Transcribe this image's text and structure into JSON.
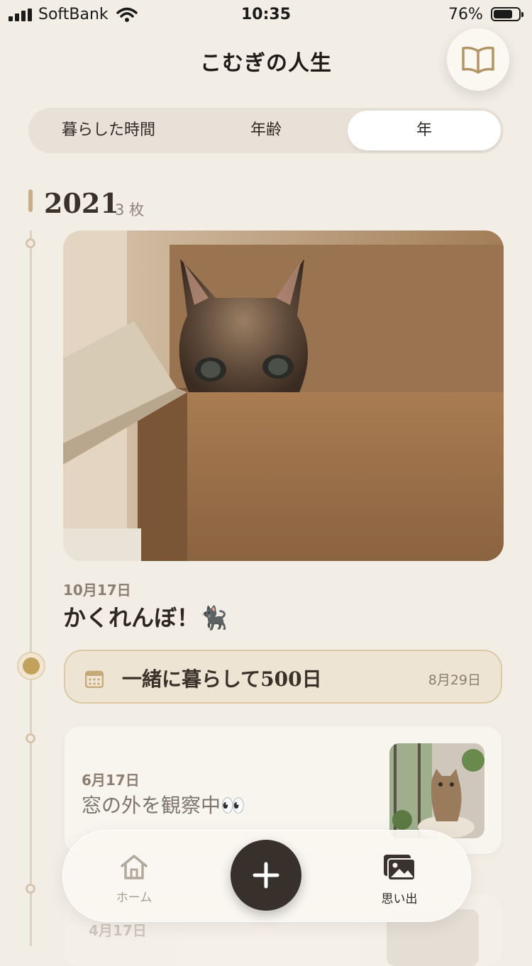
{
  "status_bar": {
    "carrier": "SoftBank",
    "time": "10:35",
    "battery": "76%",
    "battery_level": 0.76
  },
  "header": {
    "title": "こむぎの人生",
    "book_icon": "book-open-icon"
  },
  "segments": {
    "items": [
      "暮らした時間",
      "年齢",
      "年"
    ],
    "selected": "年"
  },
  "year_section": {
    "year": "2021",
    "count": "3 枚"
  },
  "entries": [
    {
      "date": "10月17日",
      "title": "かくれんぼ！🐈‍⬛"
    },
    {
      "date": "6月17日",
      "title": "窓の外を観察中👀"
    },
    {
      "date": "4月17日"
    }
  ],
  "milestone": {
    "label": "一緒に暮らして500日",
    "date": "8月29日",
    "icon": "calendar-icon"
  },
  "tabbar": {
    "home_label": "ホーム",
    "memories_label": "思い出",
    "add_icon": "plus-icon"
  },
  "colors": {
    "background": "#f2eee6",
    "accent": "#c1a15c",
    "fab": "#37302b"
  }
}
